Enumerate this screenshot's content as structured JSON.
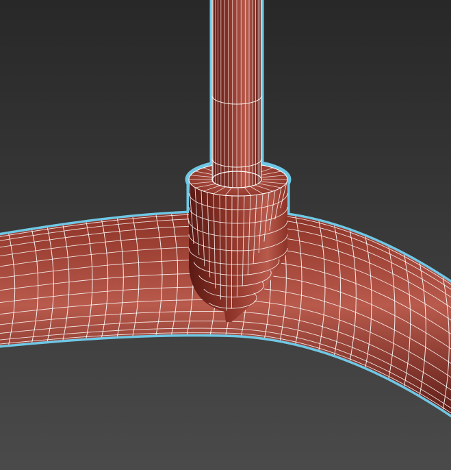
{
  "viewport": {
    "colors": {
      "background_top": "#282828",
      "background_bottom": "#4a4a4a",
      "mesh_fill_dark": "#5a1a14",
      "mesh_fill_mid": "#8c3226",
      "mesh_fill_light": "#b85a4c",
      "wire": "#ffffff",
      "selection_outline": "#6ec8e6"
    },
    "object": {
      "kind": "editable-poly-mesh",
      "selected": true,
      "show_edges": true
    }
  }
}
